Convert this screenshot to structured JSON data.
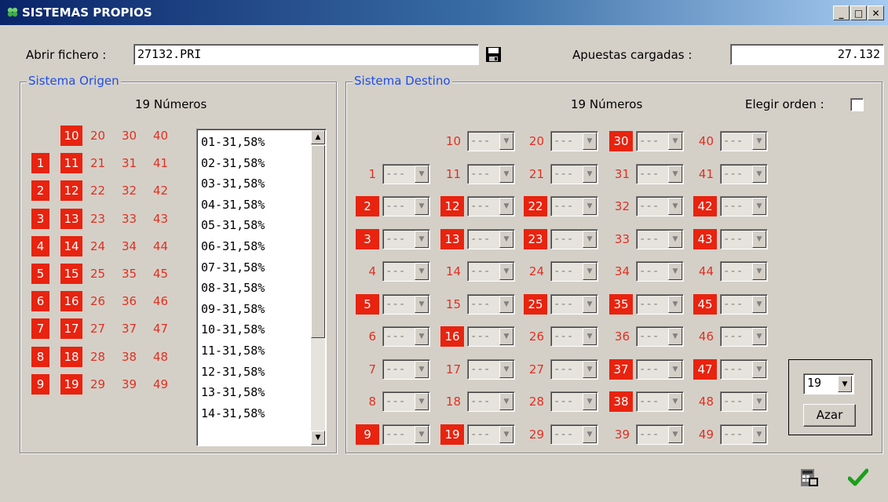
{
  "window": {
    "title": "SISTEMAS PROPIOS",
    "controls": {
      "minimize": "_",
      "maximize": "□",
      "close": "✕"
    }
  },
  "file": {
    "label": "Abrir fichero :",
    "value": "27132.PRI",
    "save_icon": "floppy-disk-icon"
  },
  "loaded": {
    "label": "Apuestas cargadas :",
    "value": "27.132"
  },
  "origen": {
    "title": "Sistema Origen",
    "count_label": "19 Números",
    "numbers": [
      [
        null,
        "10",
        "20",
        "30",
        "40"
      ],
      [
        "1",
        "11",
        "21",
        "31",
        "41"
      ],
      [
        "2",
        "12",
        "22",
        "32",
        "42"
      ],
      [
        "3",
        "13",
        "23",
        "33",
        "43"
      ],
      [
        "4",
        "14",
        "24",
        "34",
        "44"
      ],
      [
        "5",
        "15",
        "25",
        "35",
        "45"
      ],
      [
        "6",
        "16",
        "26",
        "36",
        "46"
      ],
      [
        "7",
        "17",
        "27",
        "37",
        "47"
      ],
      [
        "8",
        "18",
        "28",
        "38",
        "48"
      ],
      [
        "9",
        "19",
        "29",
        "39",
        "49"
      ]
    ],
    "selected": [
      "1",
      "2",
      "3",
      "4",
      "5",
      "6",
      "7",
      "8",
      "9",
      "10",
      "11",
      "12",
      "13",
      "14",
      "15",
      "16",
      "17",
      "18",
      "19"
    ],
    "list": [
      "01-31,58%",
      "02-31,58%",
      "03-31,58%",
      "04-31,58%",
      "05-31,58%",
      "06-31,58%",
      "07-31,58%",
      "08-31,58%",
      "09-31,58%",
      "10-31,58%",
      "11-31,58%",
      "12-31,58%",
      "13-31,58%",
      "14-31,58%"
    ]
  },
  "destino": {
    "title": "Sistema Destino",
    "count_label": "19 Números",
    "order_label": "Elegir orden :",
    "combo_placeholder": "---",
    "numbers": [
      [
        null,
        "10",
        "20",
        "30",
        "40"
      ],
      [
        "1",
        "11",
        "21",
        "31",
        "41"
      ],
      [
        "2",
        "12",
        "22",
        "32",
        "42"
      ],
      [
        "3",
        "13",
        "23",
        "33",
        "43"
      ],
      [
        "4",
        "14",
        "24",
        "34",
        "44"
      ],
      [
        "5",
        "15",
        "25",
        "35",
        "45"
      ],
      [
        "6",
        "16",
        "26",
        "36",
        "46"
      ],
      [
        "7",
        "17",
        "27",
        "37",
        "47"
      ],
      [
        "8",
        "18",
        "28",
        "38",
        "48"
      ],
      [
        "9",
        "19",
        "29",
        "39",
        "49"
      ]
    ],
    "selected": [
      "2",
      "3",
      "5",
      "9",
      "12",
      "13",
      "16",
      "19",
      "22",
      "23",
      "25",
      "30",
      "35",
      "37",
      "38",
      "42",
      "43",
      "45",
      "47"
    ]
  },
  "random": {
    "count_value": "19",
    "button_label": "Azar"
  },
  "footer": {
    "icons": [
      "calculator-window-icon",
      "checkmark-icon"
    ]
  },
  "colors": {
    "selected_bg": "#e8230f",
    "number_text": "#e03020",
    "group_title": "#1f4ee6"
  }
}
